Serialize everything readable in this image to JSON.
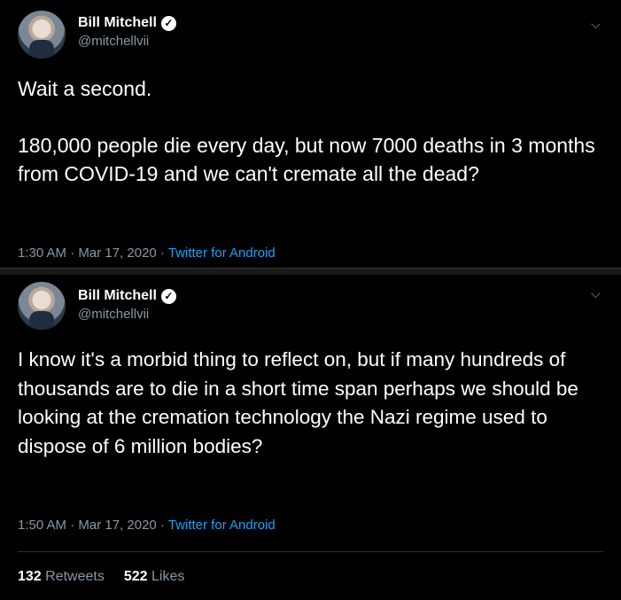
{
  "tweets": [
    {
      "display_name": "Bill Mitchell",
      "handle": "@mitchellvii",
      "verified_icon": "verified-badge-icon",
      "text": "Wait a second.\n\n180,000 people die every day, but now 7000 deaths in 3 months from COVID-19 and we can't cremate all the dead?",
      "time": "1:30 AM",
      "date": "Mar 17, 2020",
      "source": "Twitter for Android"
    },
    {
      "display_name": "Bill Mitchell",
      "handle": "@mitchellvii",
      "verified_icon": "verified-badge-icon",
      "text": "I know it's a morbid thing to reflect on, but if many hundreds of thousands are to die in a short time span perhaps we should be looking at the cremation technology the Nazi regime used to dispose of 6 million bodies?",
      "time": "1:50 AM",
      "date": "Mar 17, 2020",
      "source": "Twitter for Android",
      "retweets_count": "132",
      "retweets_label": "Retweets",
      "likes_count": "522",
      "likes_label": "Likes"
    }
  ],
  "separator": " · ",
  "colors": {
    "background": "#000000",
    "secondary_text": "#8899a6",
    "link": "#1da1f2"
  }
}
